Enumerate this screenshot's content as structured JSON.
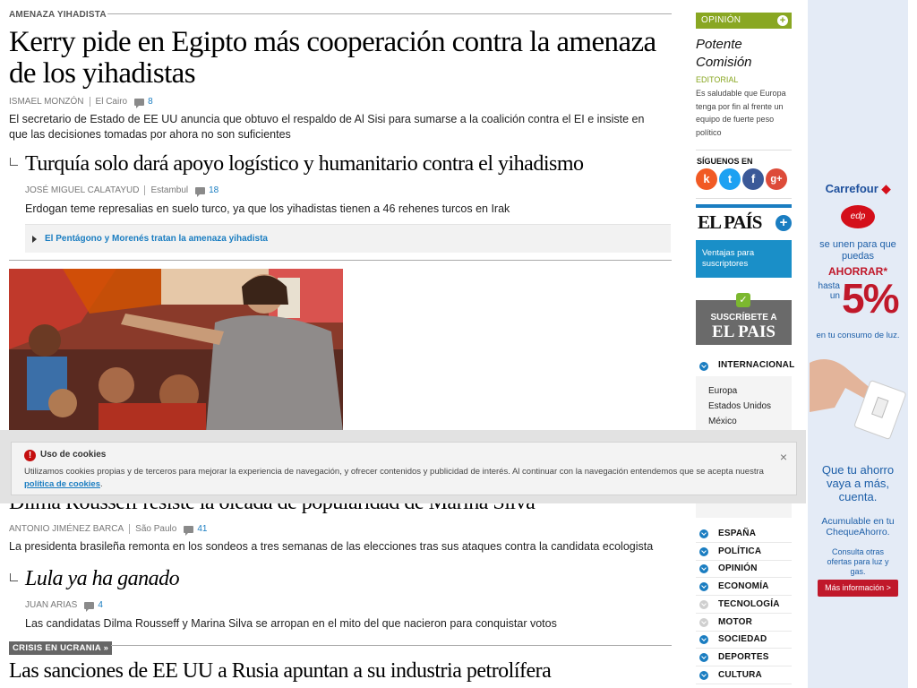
{
  "colors": {
    "accent": "#1a7dc1",
    "opinion": "#89a722",
    "alert": "#c40e0e"
  },
  "story1": {
    "kicker": "AMENAZA YIHADISTA",
    "headline": "Kerry pide en Egipto más cooperación contra la amenaza de los yihadistas",
    "author": "ISMAEL MONZÓN",
    "place": "El Cairo",
    "comments": "8",
    "lead": "El secretario de Estado de EE UU anuncia que obtuvo el respaldo de Al Sisi para sumarse a la coalición contra el EI e insiste en que las decisiones tomadas por ahora no son suficientes"
  },
  "story1b": {
    "headline": "Turquía solo dará apoyo logístico y humanitario contra el yihadismo",
    "author": "JOSÉ MIGUEL CALATAYUD",
    "place": "Estambul",
    "comments": "18",
    "lead": "Erdogan teme represalias en suelo turco, ya que los yihadistas tienen a 46 rehenes turcos en Irak",
    "related": "El Pentágono y Morenés tratan la amenaza yihadista"
  },
  "story2": {
    "headline": "Dilma Rousseff resiste la oleada de popularidad de Marina Silva",
    "author": "ANTONIO JIMÉNEZ BARCA",
    "place": "São Paulo",
    "comments": "41",
    "lead": "La presidenta brasileña remonta en los sondeos a tres semanas de las elecciones tras sus ataques contra la candidata ecologista"
  },
  "story2b": {
    "headline": "Lula ya ha ganado",
    "author": "JUAN ARIAS",
    "comments": "4",
    "lead": "Las candidatas Dilma Rousseff y Marina Silva se arropan en el mito del que nacieron para conquistar votos"
  },
  "story3": {
    "tag": "CRISIS EN UCRANIA »",
    "headline": "Las sanciones de EE UU a Rusia apuntan a su industria petrolífera"
  },
  "sidebar": {
    "opinion_label": "OPINIÓN",
    "opinion_title": "Potente Comisión",
    "opinion_section": "EDITORIAL",
    "opinion_text": "Es saludable que Europa tenga por fin al frente un equipo de fuerte peso político",
    "follow_label": "SÍGUENOS EN",
    "social": [
      {
        "name": "k",
        "color": "#f15a24"
      },
      {
        "name": "t",
        "color": "#1da1f2"
      },
      {
        "name": "f",
        "color": "#3b5998"
      },
      {
        "name": "g+",
        "color": "#dd4b39"
      }
    ],
    "brand": "EL PAÍS",
    "promo": "Ventajas para suscriptores",
    "subscribe_line1": "SUSCRÍBETE A",
    "subscribe_line2": "EL PAIS",
    "internacional_label": "INTERNACIONAL",
    "internacional_items": [
      "Europa",
      "Estados Unidos",
      "México"
    ],
    "nav": [
      {
        "label": "ESPAÑA",
        "color": "#1a7dc1"
      },
      {
        "label": "POLÍTICA",
        "color": "#1a7dc1"
      },
      {
        "label": "OPINIÓN",
        "color": "#1a7dc1"
      },
      {
        "label": "ECONOMÍA",
        "color": "#1a7dc1"
      },
      {
        "label": "TECNOLOGÍA",
        "color": "#cfcfcf"
      },
      {
        "label": "MOTOR",
        "color": "#cfcfcf"
      },
      {
        "label": "SOCIEDAD",
        "color": "#1a7dc1"
      },
      {
        "label": "DEPORTES",
        "color": "#1a7dc1"
      },
      {
        "label": "CULTURA",
        "color": "#1a7dc1"
      }
    ]
  },
  "ad": {
    "brand": "Carrefour",
    "edp": "edp",
    "line1": "se unen para que puedas",
    "ahorrar": "AHORRAR*",
    "hasta": "hasta un",
    "pct": "5%",
    "consumo": "en tu consumo de luz.",
    "slogan": "Que tu ahorro vaya a más, cuenta.",
    "acumulable": "Acumulable en tu ChequeAhorro.",
    "otras": "Consulta otras ofertas para luz y gas.",
    "cta": "Más información >"
  },
  "cookies": {
    "title": "Uso de cookies",
    "text": "Utilizamos cookies propias y de terceros para mejorar la experiencia de navegación, y ofrecer contenidos y publicidad de interés. Al continuar con la navegación entendemos que se acepta nuestra",
    "link": "política de cookies",
    "close": "×"
  }
}
